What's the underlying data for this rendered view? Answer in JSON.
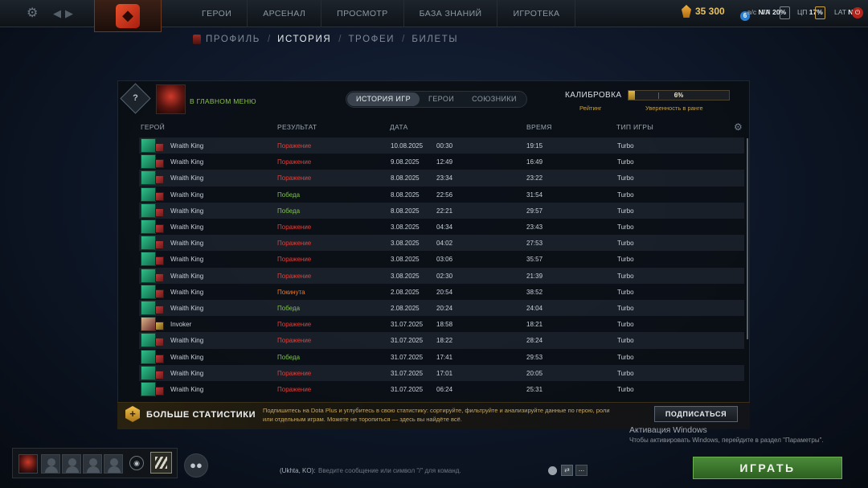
{
  "topbar": {
    "nav": [
      "ГЕРОИ",
      "АРСЕНАЛ",
      "ПРОСМОТР",
      "БАЗА ЗНАНИЙ",
      "ИГРОТЕКА"
    ],
    "shards": "35 300",
    "notifications": "6",
    "stats": [
      {
        "label": "в/с",
        "value": "N/A"
      },
      {
        "label": "ГП",
        "value": "20%"
      },
      {
        "label": "ЦП",
        "value": "17%"
      },
      {
        "label": "LAT",
        "value": "N/A"
      }
    ]
  },
  "subnav": {
    "items": [
      "ПРОФИЛЬ",
      "ИСТОРИЯ",
      "ТРОФЕИ",
      "БИЛЕТЫ"
    ],
    "active": "ИСТОРИЯ",
    "separator": "/"
  },
  "panel": {
    "rank_medal": "?",
    "status": "В ГЛАВНОМ МЕНЮ",
    "tabs": [
      {
        "label": "ИСТОРИЯ ИГР",
        "active": true
      },
      {
        "label": "ГЕРОИ",
        "active": false
      },
      {
        "label": "СОЮЗНИКИ",
        "active": false
      }
    ],
    "calibration": {
      "title": "КАЛИБРОВКА",
      "rating_label": "Рейтинг",
      "confidence_label": "Уверенность в ранге",
      "confidence": 0.06,
      "confidence_text": "6%"
    },
    "columns": {
      "hero": "ГЕРОЙ",
      "result": "РЕЗУЛЬТАТ",
      "date": "ДАТА",
      "time": "ВРЕМЯ",
      "mode": "ТИП ИГРЫ"
    },
    "matches": [
      {
        "hero": "Wraith King",
        "result": "Поражение",
        "r": "loss",
        "date": "10.08.2025",
        "start": "00:30",
        "duration": "19:15",
        "mode": "Turbo"
      },
      {
        "hero": "Wraith King",
        "result": "Поражение",
        "r": "loss",
        "date": "9.08.2025",
        "start": "12:49",
        "duration": "16:49",
        "mode": "Turbo"
      },
      {
        "hero": "Wraith King",
        "result": "Поражение",
        "r": "loss",
        "date": "8.08.2025",
        "start": "23:34",
        "duration": "23:22",
        "mode": "Turbo"
      },
      {
        "hero": "Wraith King",
        "result": "Победа",
        "r": "win",
        "date": "8.08.2025",
        "start": "22:56",
        "duration": "31:54",
        "mode": "Turbo"
      },
      {
        "hero": "Wraith King",
        "result": "Победа",
        "r": "win",
        "date": "8.08.2025",
        "start": "22:21",
        "duration": "29:57",
        "mode": "Turbo"
      },
      {
        "hero": "Wraith King",
        "result": "Поражение",
        "r": "loss",
        "date": "3.08.2025",
        "start": "04:34",
        "duration": "23:43",
        "mode": "Turbo"
      },
      {
        "hero": "Wraith King",
        "result": "Поражение",
        "r": "loss",
        "date": "3.08.2025",
        "start": "04:02",
        "duration": "27:53",
        "mode": "Turbo"
      },
      {
        "hero": "Wraith King",
        "result": "Поражение",
        "r": "loss",
        "date": "3.08.2025",
        "start": "03:06",
        "duration": "35:57",
        "mode": "Turbo"
      },
      {
        "hero": "Wraith King",
        "result": "Поражение",
        "r": "loss",
        "date": "3.08.2025",
        "start": "02:30",
        "duration": "21:39",
        "mode": "Turbo"
      },
      {
        "hero": "Wraith King",
        "result": "Покинута",
        "r": "aband",
        "date": "2.08.2025",
        "start": "20:54",
        "duration": "38:52",
        "mode": "Turbo"
      },
      {
        "hero": "Wraith King",
        "result": "Победа",
        "r": "win",
        "date": "2.08.2025",
        "start": "20:24",
        "duration": "24:04",
        "mode": "Turbo"
      },
      {
        "hero": "Invoker",
        "result": "Поражение",
        "r": "loss",
        "date": "31.07.2025",
        "start": "18:58",
        "duration": "18:21",
        "mode": "Turbo"
      },
      {
        "hero": "Wraith King",
        "result": "Поражение",
        "r": "loss",
        "date": "31.07.2025",
        "start": "18:22",
        "duration": "28:24",
        "mode": "Turbo"
      },
      {
        "hero": "Wraith King",
        "result": "Победа",
        "r": "win",
        "date": "31.07.2025",
        "start": "17:41",
        "duration": "29:53",
        "mode": "Turbo"
      },
      {
        "hero": "Wraith King",
        "result": "Поражение",
        "r": "loss",
        "date": "31.07.2025",
        "start": "17:01",
        "duration": "20:05",
        "mode": "Turbo"
      },
      {
        "hero": "Wraith King",
        "result": "Поражение",
        "r": "loss",
        "date": "31.07.2025",
        "start": "06:24",
        "duration": "25:31",
        "mode": "Turbo"
      }
    ]
  },
  "promo": {
    "title": "БОЛЬШЕ СТАТИСТИКИ",
    "text": "Подпишитесь на Dota Plus и углубитесь в свою статистику: сортируйте, фильтруйте и анализируйте данные по герою, роли или отдельным играм. Можете не торопиться — здесь вы найдёте всё.",
    "button": "ПОДПИСАТЬСЯ"
  },
  "windows_activation": {
    "title": "Активация Windows",
    "subtitle": "Чтобы активировать Windows, перейдите в раздел \"Параметры\"."
  },
  "chat": {
    "label": "(Ukhta, KO):",
    "placeholder": "Введите сообщение или символ \"/\" для команд.",
    "more": "..."
  },
  "play_button": "ИГРАТЬ",
  "colors": {
    "loss": "#e0403a",
    "win": "#7ec24a",
    "abandon": "#e87a2a",
    "accent_gold": "#e4b84a",
    "play_green": "#3a7a2c"
  }
}
